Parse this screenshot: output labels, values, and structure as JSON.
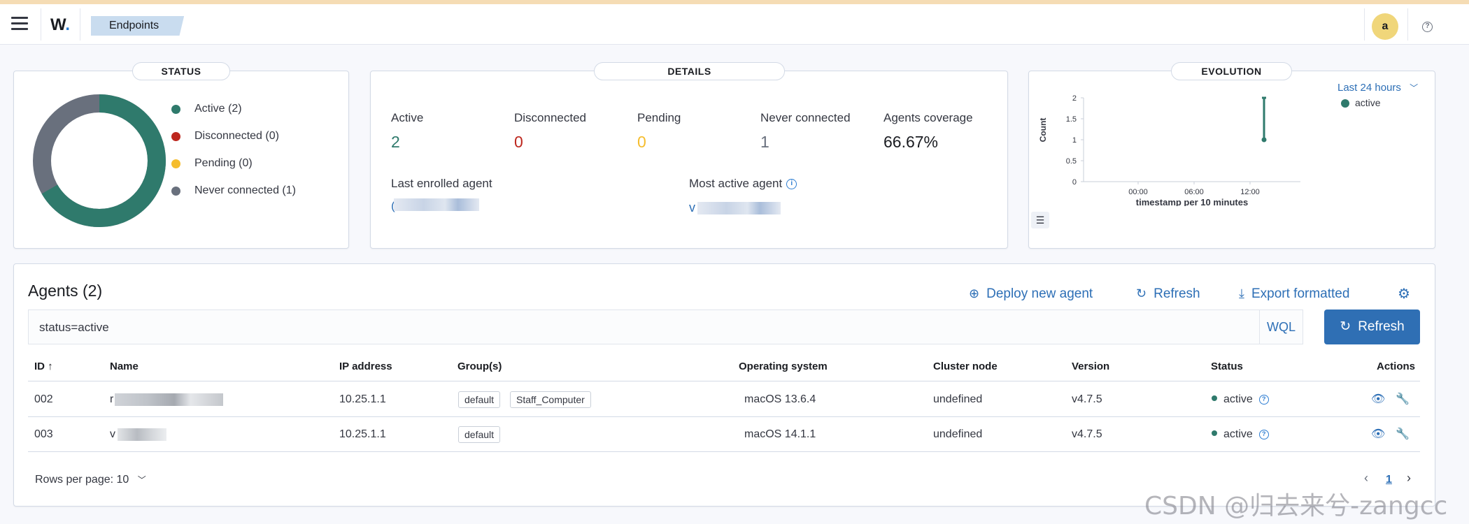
{
  "header": {
    "logo_text": "W",
    "breadcrumb": "Endpoints",
    "avatar_initial": "a",
    "help_glyph": "?"
  },
  "status_panel": {
    "title": "STATUS",
    "legend": [
      {
        "label": "Active (2)",
        "color": "#2f7a6c"
      },
      {
        "label": "Disconnected (0)",
        "color": "#bd271e"
      },
      {
        "label": "Pending (0)",
        "color": "#f5bd2e"
      },
      {
        "label": "Never connected (1)",
        "color": "#69707d"
      }
    ],
    "donut": {
      "active": 2,
      "disconnected": 0,
      "pending": 0,
      "never_connected": 1
    }
  },
  "details_panel": {
    "title": "DETAILS",
    "stats": [
      {
        "label": "Active",
        "value": "2",
        "color": "#2f7a6c"
      },
      {
        "label": "Disconnected",
        "value": "0",
        "color": "#bd271e"
      },
      {
        "label": "Pending",
        "value": "0",
        "color": "#f5bd2e"
      },
      {
        "label": "Never connected",
        "value": "1",
        "color": "#69707d"
      },
      {
        "label": "Agents coverage",
        "value": "66.67%",
        "color": "#1a1c21"
      }
    ],
    "last_enrolled_label": "Last enrolled agent",
    "last_enrolled_visible": "(",
    "most_active_label": "Most active agent",
    "most_active_visible": "v"
  },
  "evolution_panel": {
    "title": "EVOLUTION",
    "range_label": "Last 24 hours",
    "legend_label": "active",
    "chart_data": {
      "type": "line",
      "ylabel": "Count",
      "xlabel": "timestamp per 10 minutes",
      "y_ticks": [
        "2",
        "1.5",
        "1",
        "0.5",
        "0"
      ],
      "x_ticks": [
        "00:00",
        "06:00",
        "12:00"
      ],
      "ylim": [
        0,
        2
      ],
      "series": [
        {
          "name": "active",
          "points": [
            {
              "x": "13:30",
              "y": 1
            },
            {
              "x": "13:30",
              "y": 2
            }
          ]
        }
      ]
    }
  },
  "agents": {
    "title": "Agents (2)",
    "deploy_label": "Deploy new agent",
    "refresh_link_label": "Refresh",
    "export_label": "Export formatted",
    "search_value": "status=active",
    "wql_label": "WQL",
    "refresh_button_label": "Refresh",
    "columns": [
      "ID ↑",
      "Name",
      "IP address",
      "Group(s)",
      "Operating system",
      "Cluster node",
      "Version",
      "Status",
      "Actions"
    ],
    "rows": [
      {
        "id": "002",
        "name": "r",
        "ip": "10.25.1.1",
        "groups": [
          "default",
          "Staff_Computer"
        ],
        "os": "macOS 13.6.4",
        "cluster": "undefined",
        "version": "v4.7.5",
        "status": "active"
      },
      {
        "id": "003",
        "name": "v",
        "ip": "10.25.1.1",
        "groups": [
          "default"
        ],
        "os": "macOS 14.1.1",
        "cluster": "undefined",
        "version": "v4.7.5",
        "status": "active"
      }
    ],
    "rows_per_page": "Rows per page: 10",
    "current_page": "1"
  },
  "watermark": "CSDN @归去来兮-zangcc"
}
